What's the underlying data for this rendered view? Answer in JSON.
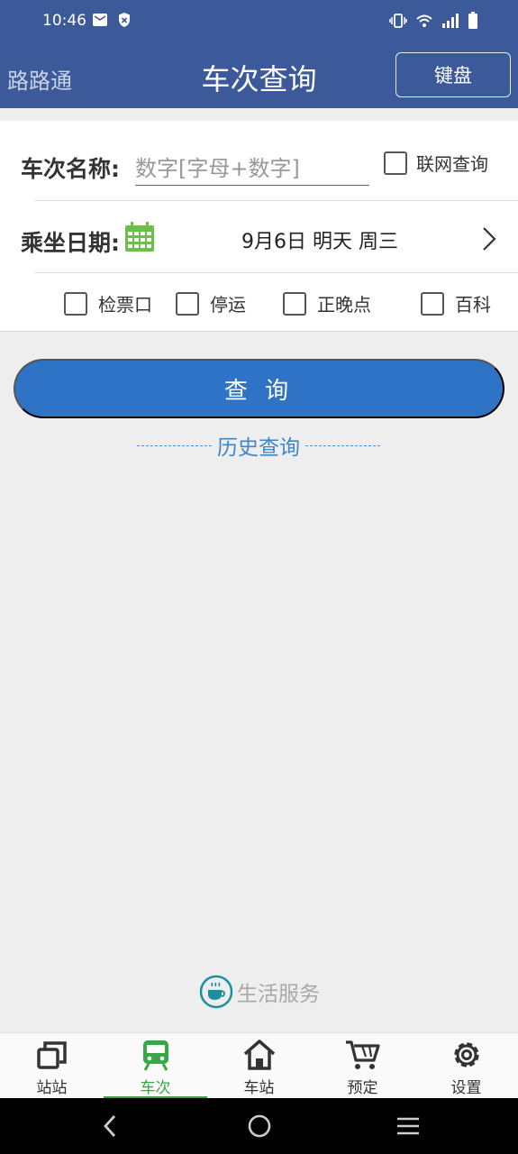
{
  "status_bar": {
    "time": "10:46"
  },
  "header": {
    "app_name": "路路通",
    "title": "车次查询",
    "keyboard_button": "键盘"
  },
  "form": {
    "train_label": "车次名称:",
    "train_placeholder": "数字[字母+数字]",
    "online_query": "联网查询",
    "date_label": "乘坐日期:",
    "date_value": "9月6日 明天 周三",
    "options": [
      "检票口",
      "停运",
      "正晚点",
      "百科"
    ]
  },
  "actions": {
    "query_button": "查 询",
    "history": "历史查询"
  },
  "life_service": "生活服务",
  "bottom_nav": {
    "items": [
      "站站",
      "车次",
      "车站",
      "预定",
      "设置"
    ],
    "active_index": 1,
    "active_color": "#3aa648"
  },
  "colors": {
    "primary": "#3c5a9a",
    "button": "#2f73c7",
    "accent_green": "#3aa648",
    "link_blue": "#3e86c9"
  }
}
